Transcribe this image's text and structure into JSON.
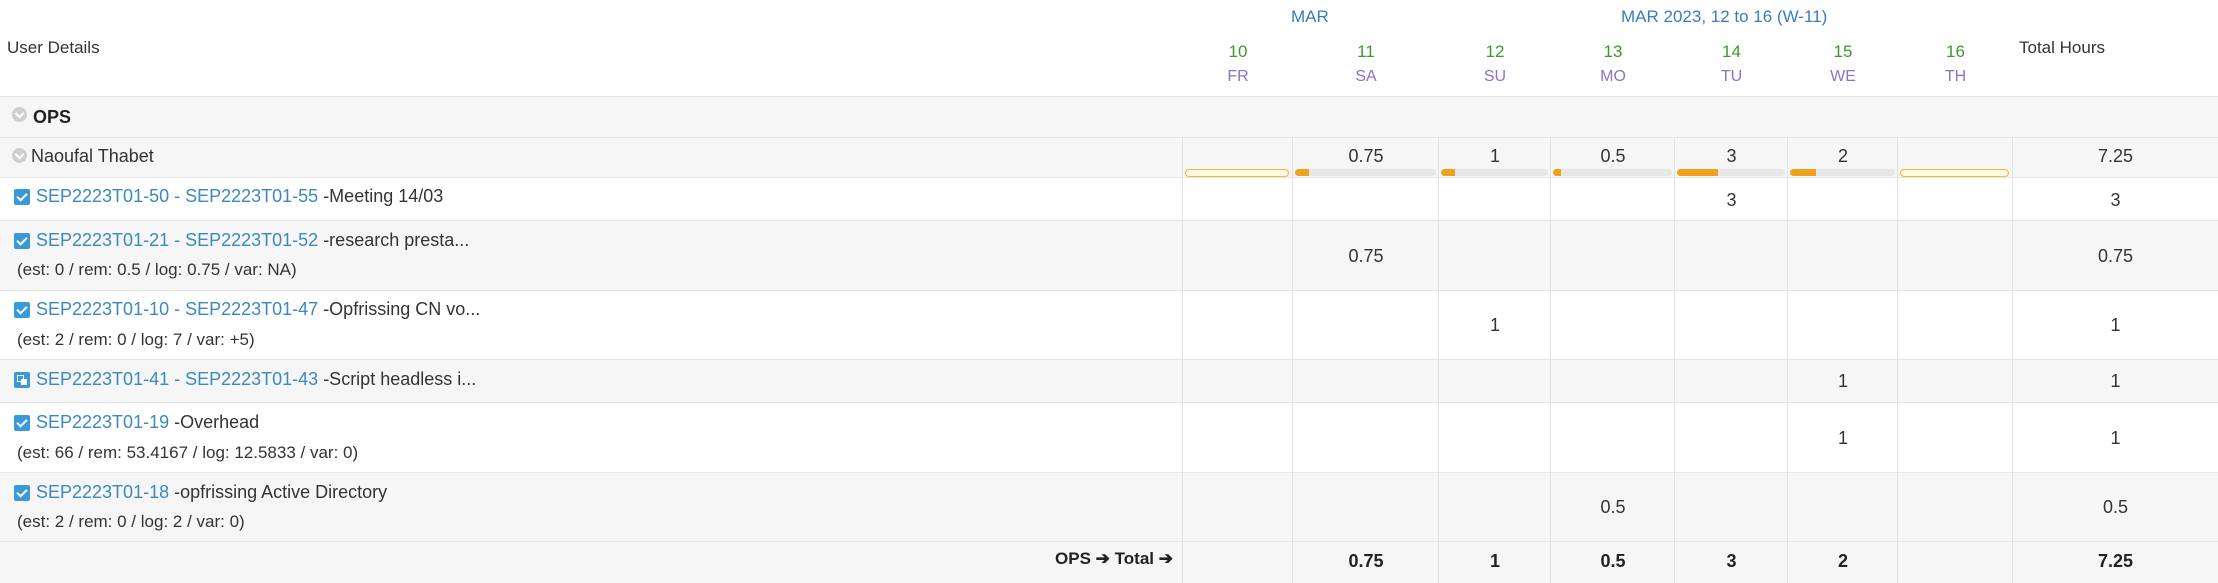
{
  "header": {
    "user_details": "User Details",
    "month_short": "MAR",
    "week_range": "MAR 2023, 12 to 16 (W-11)",
    "total_hours": "Total Hours",
    "days": [
      {
        "num": "10",
        "name": "FR"
      },
      {
        "num": "11",
        "name": "SA"
      },
      {
        "num": "12",
        "name": "SU"
      },
      {
        "num": "13",
        "name": "MO"
      },
      {
        "num": "14",
        "name": "TU"
      },
      {
        "num": "15",
        "name": "WE"
      },
      {
        "num": "16",
        "name": "TH"
      }
    ]
  },
  "group": {
    "name": "OPS"
  },
  "user": {
    "name": "Naoufal Thabet",
    "values": [
      "",
      "0.75",
      "1",
      "0.5",
      "3",
      "2",
      ""
    ],
    "total": "7.25",
    "bar_fractions": [
      0,
      0.1,
      0.13,
      0.07,
      0.38,
      0.25,
      0
    ]
  },
  "tasks": [
    {
      "link": "SEP2223T01-50 - SEP2223T01-55",
      "title": " -Meeting 14/03",
      "meta": "",
      "icon": "checkbox-icon",
      "values": [
        "",
        "",
        "",
        "",
        "3",
        "",
        ""
      ],
      "total": "3"
    },
    {
      "link": "SEP2223T01-21 - SEP2223T01-52",
      "title": " -research presta...",
      "meta": "(est: 0 / rem: 0.5 / log: 0.75 / var: NA)",
      "icon": "checkbox-icon",
      "values": [
        "",
        "0.75",
        "",
        "",
        "",
        "",
        ""
      ],
      "total": "0.75"
    },
    {
      "link": "SEP2223T01-10 - SEP2223T01-47",
      "title": " -Opfrissing CN vo...",
      "meta": "(est: 2 / rem: 0 / log: 7 / var: +5)",
      "icon": "checkbox-icon",
      "values": [
        "",
        "",
        "1",
        "",
        "",
        "",
        ""
      ],
      "total": "1"
    },
    {
      "link": "SEP2223T01-41 - SEP2223T01-43",
      "title": " -Script headless i...",
      "meta": "",
      "icon": "subtask-icon",
      "values": [
        "",
        "",
        "",
        "",
        "",
        "1",
        ""
      ],
      "total": "1"
    },
    {
      "link": "SEP2223T01-19",
      "title": " -Overhead",
      "meta": "(est: 66 / rem: 53.4167 / log: 12.5833 / var: 0)",
      "icon": "checkbox-icon",
      "values": [
        "",
        "",
        "",
        "",
        "",
        "1",
        ""
      ],
      "total": "1"
    },
    {
      "link": "SEP2223T01-18",
      "title": " -opfrissing Active Directory",
      "meta": "(est: 2 / rem: 0 / log: 2 / var: 0)",
      "icon": "checkbox-icon",
      "values": [
        "",
        "",
        "",
        "0.5",
        "",
        "",
        ""
      ],
      "total": "0.5"
    }
  ],
  "footer": {
    "group": "OPS",
    "arrow": "➔",
    "total_label": "Total",
    "values": [
      "",
      "0.75",
      "1",
      "0.5",
      "3",
      "2",
      ""
    ],
    "total": "7.25"
  },
  "colors": {
    "day_number": "#3d9a2c",
    "day_name": "#8a73c9",
    "month": "#3a7bbf",
    "link": "#3a89c2",
    "bar_fill": "#f0a21c"
  }
}
